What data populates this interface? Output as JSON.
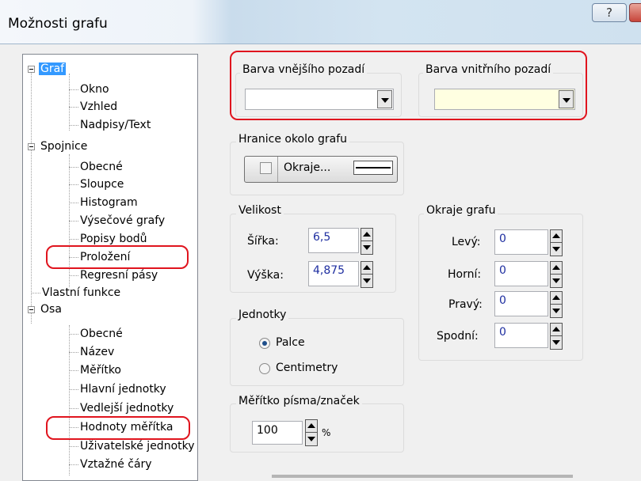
{
  "window": {
    "title": "Možnosti grafu",
    "help_label": "?"
  },
  "tree": [
    {
      "label": "Graf",
      "selected": true
    },
    {
      "label": "Okno"
    },
    {
      "label": "Vzhled"
    },
    {
      "label": "Nadpisy/Text"
    },
    {
      "label": "Spojnice"
    },
    {
      "label": "Obecné"
    },
    {
      "label": "Sloupce"
    },
    {
      "label": "Histogram"
    },
    {
      "label": "Výsečové grafy"
    },
    {
      "label": "Popisy bodů"
    },
    {
      "label": "Proložení",
      "highlighted": true
    },
    {
      "label": "Regresní pásy"
    },
    {
      "label": "Vlastní funkce"
    },
    {
      "label": "Osa"
    },
    {
      "label": "Obecné"
    },
    {
      "label": "Název"
    },
    {
      "label": "Měřítko"
    },
    {
      "label": "Hlavní jednotky"
    },
    {
      "label": "Vedlejší jednotky"
    },
    {
      "label": "Hodnoty měřítka",
      "highlighted": true
    },
    {
      "label": "Uživatelské jednotky"
    },
    {
      "label": "Vztažné čáry"
    }
  ],
  "background": {
    "outer_label": "Barva vnějšího pozadí",
    "outer_color": "#ffffff",
    "inner_label": "Barva vnitřního pozadí",
    "inner_color": "#ffffe1"
  },
  "border": {
    "group_label": "Hranice okolo grafu",
    "button_label": "Okraje..."
  },
  "size": {
    "group_label": "Velikost",
    "width_label": "Šířka:",
    "width_value": "6,5",
    "height_label": "Výška:",
    "height_value": "4,875"
  },
  "margins": {
    "group_label": "Okraje grafu",
    "left_label": "Levý:",
    "left_value": "0",
    "top_label": "Horní:",
    "top_value": "0",
    "right_label": "Pravý:",
    "right_value": "0",
    "bottom_label": "Spodní:",
    "bottom_value": "0"
  },
  "units": {
    "group_label": "Jednotky",
    "option_inches": "Palce",
    "option_cm": "Centimetry",
    "selected": "Palce"
  },
  "scale": {
    "group_label": "Měřítko písma/značek",
    "value": "100",
    "unit": "%"
  },
  "colors": {
    "highlight": "#e0141e",
    "selection": "#3399ff",
    "value_text": "#1e2ea0"
  }
}
